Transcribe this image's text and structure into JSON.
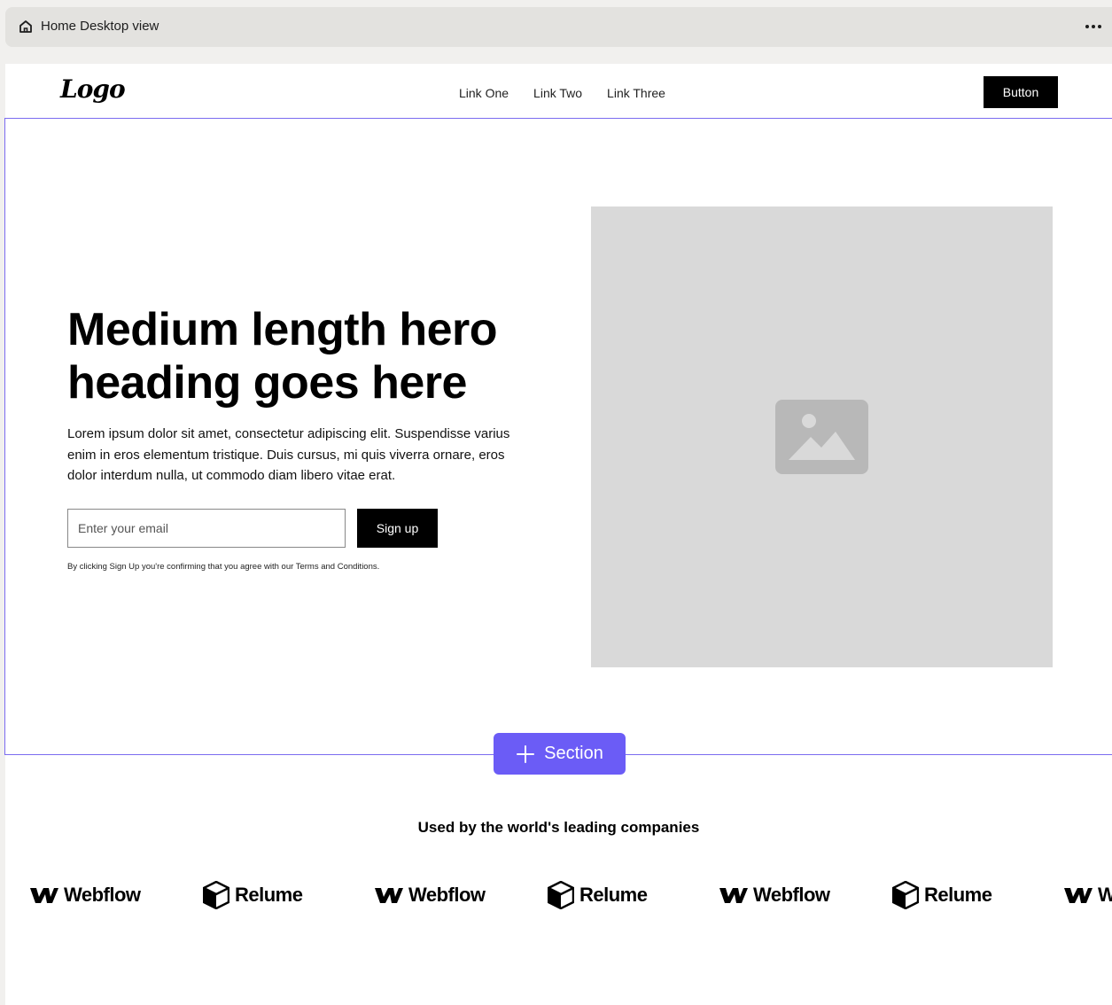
{
  "window": {
    "title": "Home Desktop view"
  },
  "nav": {
    "logo": "Logo",
    "links": [
      "Link One",
      "Link Two",
      "Link Three"
    ],
    "button": "Button"
  },
  "hero": {
    "heading": "Medium length hero heading goes here",
    "body": "Lorem ipsum dolor sit amet, consectetur adipiscing elit. Suspendisse varius enim in eros elementum tristique. Duis cursus, mi quis viverra ornare, eros dolor interdum nulla, ut commodo diam libero vitae erat.",
    "email_placeholder": "Enter your email",
    "signup": "Sign up",
    "terms": "By clicking Sign Up you're confirming that you agree with our Terms and Conditions."
  },
  "add_section": "Section",
  "logos": {
    "heading": "Used by the world's leading companies",
    "items": [
      {
        "name": "Webflow",
        "icon": "webflow-icon"
      },
      {
        "name": "Relume",
        "icon": "relume-icon"
      },
      {
        "name": "Webflow",
        "icon": "webflow-icon"
      },
      {
        "name": "Relume",
        "icon": "relume-icon"
      },
      {
        "name": "Webflow",
        "icon": "webflow-icon"
      },
      {
        "name": "Relume",
        "icon": "relume-icon"
      },
      {
        "name": "Webflow",
        "icon": "webflow-icon"
      }
    ]
  },
  "colors": {
    "accent": "#6b5cf6",
    "outline": "#7b6cf0",
    "placeholder": "#d9d9d9"
  }
}
